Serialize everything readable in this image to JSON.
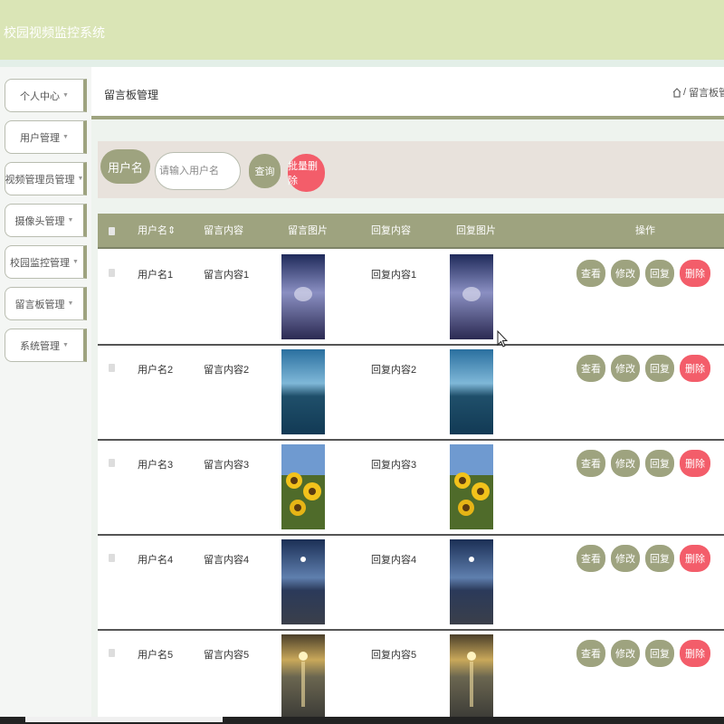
{
  "app": {
    "title": "校园视频监控系统"
  },
  "sidebar": {
    "items": [
      {
        "label": "个人中心"
      },
      {
        "label": "用户管理"
      },
      {
        "label": "视频管理员管理"
      },
      {
        "label": "摄像头管理"
      },
      {
        "label": "校园监控管理"
      },
      {
        "label": "留言板管理"
      },
      {
        "label": "系统管理"
      }
    ],
    "caret": "▼"
  },
  "header": {
    "page_title": "留言板管理",
    "breadcrumb_sep": "/",
    "breadcrumb_current": "留言板管理",
    "breadcrumb_trailing": "/"
  },
  "search": {
    "label": "用户名",
    "placeholder": "请输入用户名",
    "query_button": "查询",
    "batch_delete_button": "批量删除"
  },
  "table": {
    "columns": {
      "username": "用户名",
      "sort_icon": "⇕",
      "message": "留言内容",
      "message_image": "留言图片",
      "reply": "回复内容",
      "reply_image": "回复图片",
      "actions": "操作"
    },
    "action_labels": {
      "view": "查看",
      "edit": "修改",
      "reply": "回复",
      "delete": "删除"
    },
    "rows": [
      {
        "username": "用户名1",
        "message": "留言内容1",
        "reply": "回复内容1",
        "image": "night-sky-photo"
      },
      {
        "username": "用户名2",
        "message": "留言内容2",
        "reply": "回复内容2",
        "image": "lake-mountain-photo"
      },
      {
        "username": "用户名3",
        "message": "留言内容3",
        "reply": "回复内容3",
        "image": "sunflowers-photo"
      },
      {
        "username": "用户名4",
        "message": "留言内容4",
        "reply": "回复内容4",
        "image": "starry-coast-photo"
      },
      {
        "username": "用户名5",
        "message": "留言内容5",
        "reply": "回复内容5",
        "image": "sunset-beach-photo"
      }
    ]
  },
  "colors": {
    "primary": "#9ea37f",
    "danger": "#f35d6a",
    "topbar": "#dae5b6",
    "search_bg": "#e8e2dc"
  }
}
